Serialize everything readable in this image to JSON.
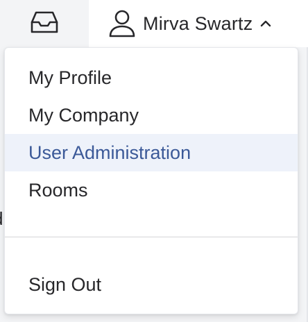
{
  "header": {
    "inbox_icon": "inbox-icon",
    "user": {
      "icon": "user-icon",
      "name": "Mirva Swartz",
      "chevron": "chevron-up-icon"
    }
  },
  "background": {
    "fragment_text": "d"
  },
  "menu": {
    "items": [
      {
        "label": "My Profile",
        "active": false
      },
      {
        "label": "My Company",
        "active": false
      },
      {
        "label": "User Administration",
        "active": true
      },
      {
        "label": "Rooms",
        "active": false
      }
    ],
    "sign_out_label": "Sign Out"
  },
  "colors": {
    "accent_text": "#3b5998",
    "active_bg": "#eef2fa",
    "text": "#27272a"
  }
}
